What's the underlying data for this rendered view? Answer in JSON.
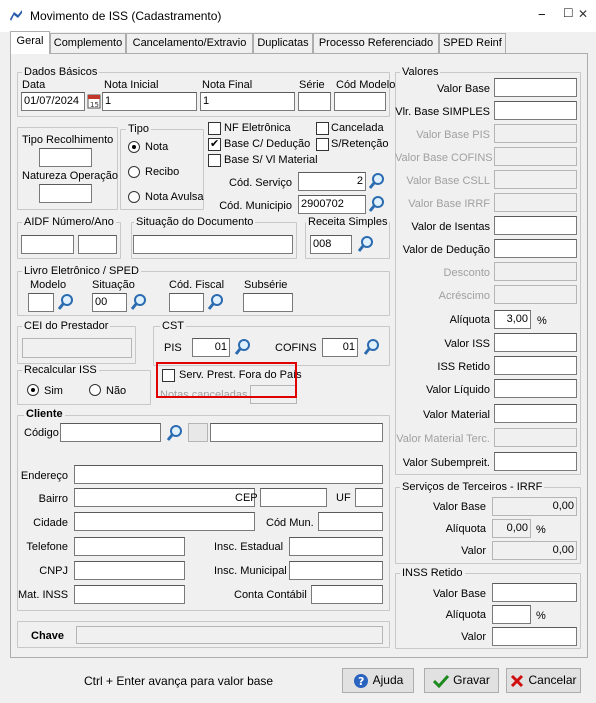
{
  "window": {
    "title": "Movimento de ISS (Cadastramento)",
    "min": "−",
    "max": "□",
    "close": "✕"
  },
  "tabs": [
    "Geral",
    "Complemento",
    "Cancelamento/Extravio",
    "Duplicatas",
    "Processo Referenciado",
    "SPED Reinf"
  ],
  "dados_basicos": {
    "title": "Dados Básicos",
    "data_label": "Data",
    "data_value": "01/07/2024",
    "nota_inicial_label": "Nota Inicial",
    "nota_inicial_value": "1",
    "nota_final_label": "Nota Final",
    "nota_final_value": "1",
    "serie_label": "Série",
    "cod_modelo_label": "Cód Modelo"
  },
  "tipo_recolhimento": {
    "label": "Tipo Recolhimento",
    "natureza_label": "Natureza Operação"
  },
  "tipo": {
    "title": "Tipo",
    "options": [
      "Nota",
      "Recibo",
      "Nota Avulsa"
    ],
    "selected": "Nota"
  },
  "flags": {
    "nf_eletronica": "NF Eletrônica",
    "cancelada": "Cancelada",
    "base_c_deducao": "Base C/ Dedução",
    "s_retencao": "S/Retenção",
    "base_s_vl_material": "Base S/ Vl Material"
  },
  "servico": {
    "cod_servico_label": "Cód. Serviço",
    "cod_servico_value": "2",
    "cod_municipio_label": "Cód. Municipio",
    "cod_municipio_value": "2900702"
  },
  "aidf": {
    "label": "AIDF Número/Ano"
  },
  "situacao": {
    "label": "Situação do Documento"
  },
  "receita": {
    "label": "Receita Simples",
    "value": "008"
  },
  "livro": {
    "title": "Livro Eletrônico / SPED",
    "modelo_label": "Modelo",
    "situacao_label": "Situação",
    "situacao_value": "00",
    "cod_fiscal_label": "Cód. Fiscal",
    "subserie_label": "Subsérie"
  },
  "cei": {
    "label": "CEI do Prestador"
  },
  "cst": {
    "title": "CST",
    "pis_label": "PIS",
    "pis_value": "01",
    "cofins_label": "COFINS",
    "cofins_value": "01"
  },
  "recalcular": {
    "title": "Recalcular ISS",
    "sim": "Sim",
    "nao": "Não"
  },
  "serv_prest": {
    "label": "Serv. Prest. Fora do País",
    "notas_canceladas": "Notas canceladas"
  },
  "cliente": {
    "title": "Cliente",
    "codigo_label": "Código",
    "endereco_label": "Endereço",
    "bairro_label": "Bairro",
    "cep_label": "CEP",
    "uf_label": "UF",
    "cidade_label": "Cidade",
    "cod_mun_label": "Cód Mun.",
    "telefone_label": "Telefone",
    "insc_estadual_label": "Insc. Estadual",
    "cnpj_label": "CNPJ",
    "insc_municipal_label": "Insc. Municipal",
    "mat_inss_label": "Mat. INSS",
    "conta_contabil_label": "Conta Contábil"
  },
  "chave": {
    "label": "Chave"
  },
  "valores": {
    "title": "Valores",
    "rows": [
      {
        "label": "Valor Base",
        "enabled": true
      },
      {
        "label": "Vlr. Base SIMPLES",
        "enabled": true
      },
      {
        "label": "Valor Base PIS",
        "enabled": false
      },
      {
        "label": "Valor Base COFINS",
        "enabled": false
      },
      {
        "label": "Valor Base CSLL",
        "enabled": false
      },
      {
        "label": "Valor Base IRRF",
        "enabled": false
      },
      {
        "label": "Valor de Isentas",
        "enabled": true
      },
      {
        "label": "Valor de Dedução",
        "enabled": true
      },
      {
        "label": "Desconto",
        "enabled": false
      },
      {
        "label": "Acréscimo",
        "enabled": false
      }
    ],
    "aliquota_label": "Alíquota",
    "aliquota_value": "3,00",
    "pct": "%",
    "rows2": [
      {
        "label": "Valor ISS",
        "enabled": true
      },
      {
        "label": "ISS Retido",
        "enabled": true
      },
      {
        "label": "Valor Líquido",
        "enabled": true
      },
      {
        "label": "Valor Material",
        "enabled": true
      },
      {
        "label": "Valor Material Terc.",
        "enabled": false
      },
      {
        "label": "Valor Subempreit.",
        "enabled": true
      }
    ]
  },
  "irrf": {
    "title": "Serviços de Terceiros - IRRF",
    "valor_base_label": "Valor Base",
    "valor_base_value": "0,00",
    "aliquota_label": "Alíquota",
    "aliquota_value": "0,00",
    "pct": "%",
    "valor_label": "Valor",
    "valor_value": "0,00"
  },
  "inss": {
    "title": "INSS Retido",
    "valor_base_label": "Valor Base",
    "aliquota_label": "Alíquota",
    "pct": "%",
    "valor_label": "Valor"
  },
  "footer": {
    "hint": "Ctrl + Enter avança para valor base",
    "ajuda": "Ajuda",
    "gravar": "Gravar",
    "cancelar": "Cancelar"
  }
}
